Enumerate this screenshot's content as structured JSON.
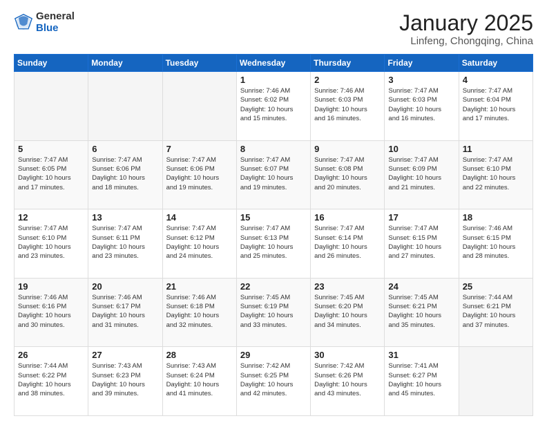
{
  "header": {
    "logo_general": "General",
    "logo_blue": "Blue",
    "month": "January 2025",
    "location": "Linfeng, Chongqing, China"
  },
  "days_of_week": [
    "Sunday",
    "Monday",
    "Tuesday",
    "Wednesday",
    "Thursday",
    "Friday",
    "Saturday"
  ],
  "weeks": [
    [
      {
        "day": "",
        "info": ""
      },
      {
        "day": "",
        "info": ""
      },
      {
        "day": "",
        "info": ""
      },
      {
        "day": "1",
        "info": "Sunrise: 7:46 AM\nSunset: 6:02 PM\nDaylight: 10 hours\nand 15 minutes."
      },
      {
        "day": "2",
        "info": "Sunrise: 7:46 AM\nSunset: 6:03 PM\nDaylight: 10 hours\nand 16 minutes."
      },
      {
        "day": "3",
        "info": "Sunrise: 7:47 AM\nSunset: 6:03 PM\nDaylight: 10 hours\nand 16 minutes."
      },
      {
        "day": "4",
        "info": "Sunrise: 7:47 AM\nSunset: 6:04 PM\nDaylight: 10 hours\nand 17 minutes."
      }
    ],
    [
      {
        "day": "5",
        "info": "Sunrise: 7:47 AM\nSunset: 6:05 PM\nDaylight: 10 hours\nand 17 minutes."
      },
      {
        "day": "6",
        "info": "Sunrise: 7:47 AM\nSunset: 6:06 PM\nDaylight: 10 hours\nand 18 minutes."
      },
      {
        "day": "7",
        "info": "Sunrise: 7:47 AM\nSunset: 6:06 PM\nDaylight: 10 hours\nand 19 minutes."
      },
      {
        "day": "8",
        "info": "Sunrise: 7:47 AM\nSunset: 6:07 PM\nDaylight: 10 hours\nand 19 minutes."
      },
      {
        "day": "9",
        "info": "Sunrise: 7:47 AM\nSunset: 6:08 PM\nDaylight: 10 hours\nand 20 minutes."
      },
      {
        "day": "10",
        "info": "Sunrise: 7:47 AM\nSunset: 6:09 PM\nDaylight: 10 hours\nand 21 minutes."
      },
      {
        "day": "11",
        "info": "Sunrise: 7:47 AM\nSunset: 6:10 PM\nDaylight: 10 hours\nand 22 minutes."
      }
    ],
    [
      {
        "day": "12",
        "info": "Sunrise: 7:47 AM\nSunset: 6:10 PM\nDaylight: 10 hours\nand 23 minutes."
      },
      {
        "day": "13",
        "info": "Sunrise: 7:47 AM\nSunset: 6:11 PM\nDaylight: 10 hours\nand 23 minutes."
      },
      {
        "day": "14",
        "info": "Sunrise: 7:47 AM\nSunset: 6:12 PM\nDaylight: 10 hours\nand 24 minutes."
      },
      {
        "day": "15",
        "info": "Sunrise: 7:47 AM\nSunset: 6:13 PM\nDaylight: 10 hours\nand 25 minutes."
      },
      {
        "day": "16",
        "info": "Sunrise: 7:47 AM\nSunset: 6:14 PM\nDaylight: 10 hours\nand 26 minutes."
      },
      {
        "day": "17",
        "info": "Sunrise: 7:47 AM\nSunset: 6:15 PM\nDaylight: 10 hours\nand 27 minutes."
      },
      {
        "day": "18",
        "info": "Sunrise: 7:46 AM\nSunset: 6:15 PM\nDaylight: 10 hours\nand 28 minutes."
      }
    ],
    [
      {
        "day": "19",
        "info": "Sunrise: 7:46 AM\nSunset: 6:16 PM\nDaylight: 10 hours\nand 30 minutes."
      },
      {
        "day": "20",
        "info": "Sunrise: 7:46 AM\nSunset: 6:17 PM\nDaylight: 10 hours\nand 31 minutes."
      },
      {
        "day": "21",
        "info": "Sunrise: 7:46 AM\nSunset: 6:18 PM\nDaylight: 10 hours\nand 32 minutes."
      },
      {
        "day": "22",
        "info": "Sunrise: 7:45 AM\nSunset: 6:19 PM\nDaylight: 10 hours\nand 33 minutes."
      },
      {
        "day": "23",
        "info": "Sunrise: 7:45 AM\nSunset: 6:20 PM\nDaylight: 10 hours\nand 34 minutes."
      },
      {
        "day": "24",
        "info": "Sunrise: 7:45 AM\nSunset: 6:21 PM\nDaylight: 10 hours\nand 35 minutes."
      },
      {
        "day": "25",
        "info": "Sunrise: 7:44 AM\nSunset: 6:21 PM\nDaylight: 10 hours\nand 37 minutes."
      }
    ],
    [
      {
        "day": "26",
        "info": "Sunrise: 7:44 AM\nSunset: 6:22 PM\nDaylight: 10 hours\nand 38 minutes."
      },
      {
        "day": "27",
        "info": "Sunrise: 7:43 AM\nSunset: 6:23 PM\nDaylight: 10 hours\nand 39 minutes."
      },
      {
        "day": "28",
        "info": "Sunrise: 7:43 AM\nSunset: 6:24 PM\nDaylight: 10 hours\nand 41 minutes."
      },
      {
        "day": "29",
        "info": "Sunrise: 7:42 AM\nSunset: 6:25 PM\nDaylight: 10 hours\nand 42 minutes."
      },
      {
        "day": "30",
        "info": "Sunrise: 7:42 AM\nSunset: 6:26 PM\nDaylight: 10 hours\nand 43 minutes."
      },
      {
        "day": "31",
        "info": "Sunrise: 7:41 AM\nSunset: 6:27 PM\nDaylight: 10 hours\nand 45 minutes."
      },
      {
        "day": "",
        "info": ""
      }
    ]
  ]
}
